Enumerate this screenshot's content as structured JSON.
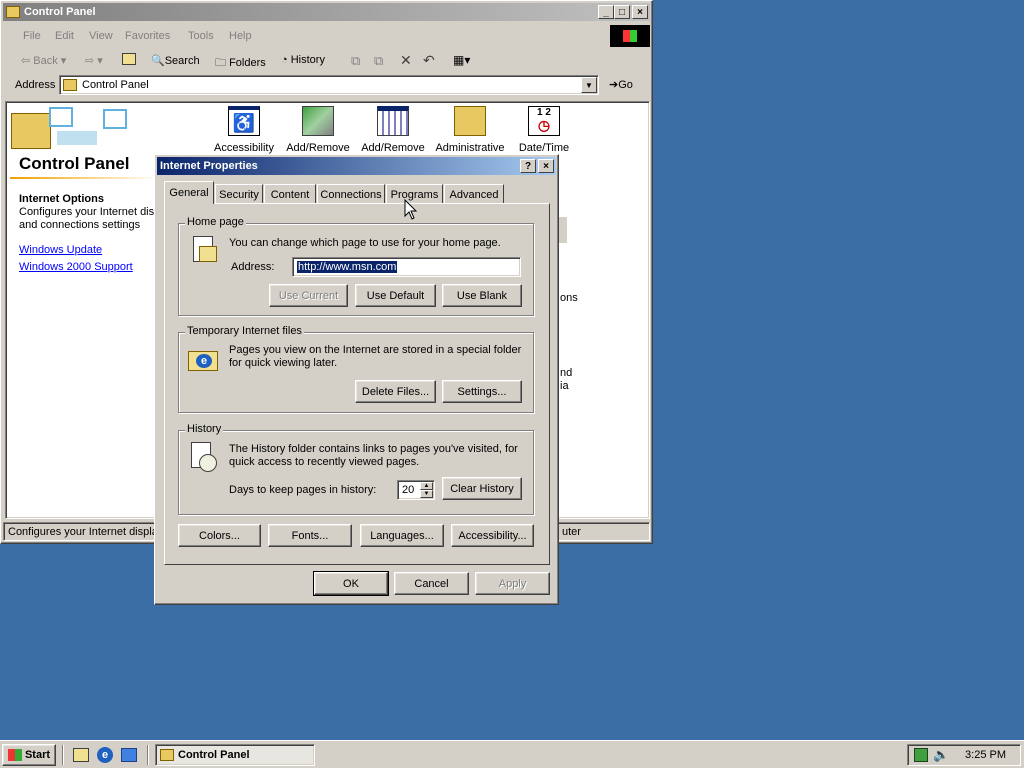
{
  "control_panel": {
    "title": "Control Panel",
    "menu": [
      "File",
      "Edit",
      "View",
      "Favorites",
      "Tools",
      "Help"
    ],
    "toolbar": {
      "back": "Back",
      "search": "Search",
      "folders": "Folders",
      "history": "History"
    },
    "address_label": "Address",
    "address_value": "Control Panel",
    "go_label": "Go",
    "heading": "Control Panel",
    "info_title": "Internet Options",
    "info_desc_1": "Configures your Internet dis",
    "info_desc_2": "and connections settings",
    "links": [
      "Windows Update",
      "Windows 2000 Support"
    ],
    "icons": [
      {
        "label": "Accessibility",
        "icon": "accessibility-icon"
      },
      {
        "label": "Add/Remove",
        "icon": "add-remove-hardware-icon"
      },
      {
        "label": "Add/Remove",
        "icon": "add-remove-programs-icon"
      },
      {
        "label": "Administrative",
        "icon": "administrative-tools-icon"
      },
      {
        "label": "Date/Time",
        "icon": "date-time-icon"
      }
    ],
    "partial_texts": [
      "ons",
      "nd",
      "ia"
    ],
    "status_text": "Configures your Internet displa",
    "status_right": "uter"
  },
  "dialog": {
    "title": "Internet Properties",
    "tabs": [
      "General",
      "Security",
      "Content",
      "Connections",
      "Programs",
      "Advanced"
    ],
    "active_tab": "General",
    "home_page": {
      "group_label": "Home page",
      "desc": "You can change which page to use for your home page.",
      "address_label": "Address:",
      "address_value": "http://www.msn.com",
      "use_current": "Use Current",
      "use_default": "Use Default",
      "use_blank": "Use Blank"
    },
    "temp_files": {
      "group_label": "Temporary Internet files",
      "desc_1": "Pages you view on the Internet are stored in a special folder",
      "desc_2": "for quick viewing later.",
      "delete_files": "Delete Files...",
      "settings": "Settings..."
    },
    "history": {
      "group_label": "History",
      "desc_1": "The History folder contains links to pages you've visited, for",
      "desc_2": "quick access to recently viewed pages.",
      "days_label": "Days to keep pages in history:",
      "days_value": "20",
      "clear_history": "Clear History"
    },
    "bottom_buttons": {
      "colors": "Colors...",
      "fonts": "Fonts...",
      "languages": "Languages...",
      "accessibility": "Accessibility..."
    },
    "ok": "OK",
    "cancel": "Cancel",
    "apply": "Apply"
  },
  "taskbar": {
    "start": "Start",
    "task": "Control Panel",
    "clock": "3:25 PM"
  },
  "colors": {
    "desktop": "#3a6ea5",
    "title_active": "#0a246a",
    "face": "#d4d0c8"
  }
}
